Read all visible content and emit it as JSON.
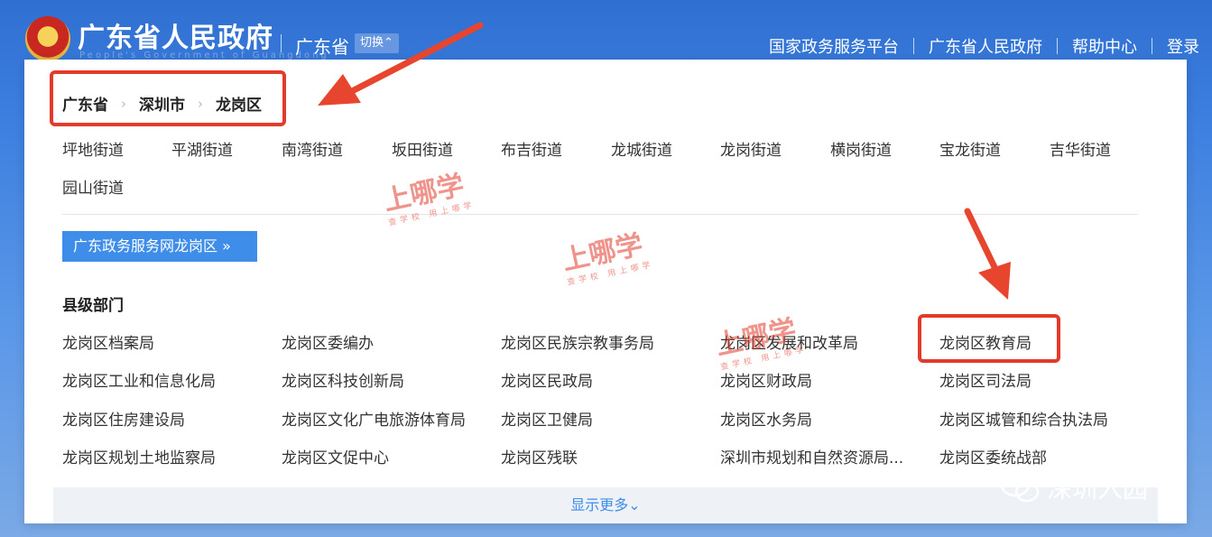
{
  "header": {
    "site_title": "广东省人民政府",
    "site_subtitle": "People's Government of Guangdong",
    "region": "广东省",
    "switch_label": "切换⌃",
    "links": [
      "国家政务服务平台",
      "广东省人民政府",
      "帮助中心",
      "登录"
    ]
  },
  "breadcrumb": [
    "广东省",
    "深圳市",
    "龙岗区"
  ],
  "streets": [
    "坪地街道",
    "平湖街道",
    "南湾街道",
    "坂田街道",
    "布吉街道",
    "龙城街道",
    "龙岗街道",
    "横岗街道",
    "宝龙街道",
    "吉华街道",
    "园山街道"
  ],
  "portal_button": "广东政务服务网龙岗区 »",
  "section_title": "县级部门",
  "departments": [
    "龙岗区档案局",
    "龙岗区委编办",
    "龙岗区民族宗教事务局",
    "龙岗区发展和改革局",
    "龙岗区教育局",
    "龙岗区工业和信息化局",
    "龙岗区科技创新局",
    "龙岗区民政局",
    "龙岗区财政局",
    "龙岗区司法局",
    "龙岗区住房建设局",
    "龙岗区文化广电旅游体育局",
    "龙岗区卫健局",
    "龙岗区水务局",
    "龙岗区城管和综合执法局",
    "龙岗区规划土地监察局",
    "龙岗区文促中心",
    "龙岗区残联",
    "深圳市规划和自然资源局...",
    "龙岗区委统战部"
  ],
  "show_more": "显示更多⌄",
  "watermark": {
    "big": "上哪学",
    "small": "查学校 用上哪学"
  },
  "wechat_label": "深圳入园",
  "colors": {
    "accent": "#3e8de8",
    "highlight": "#e23b2b"
  }
}
